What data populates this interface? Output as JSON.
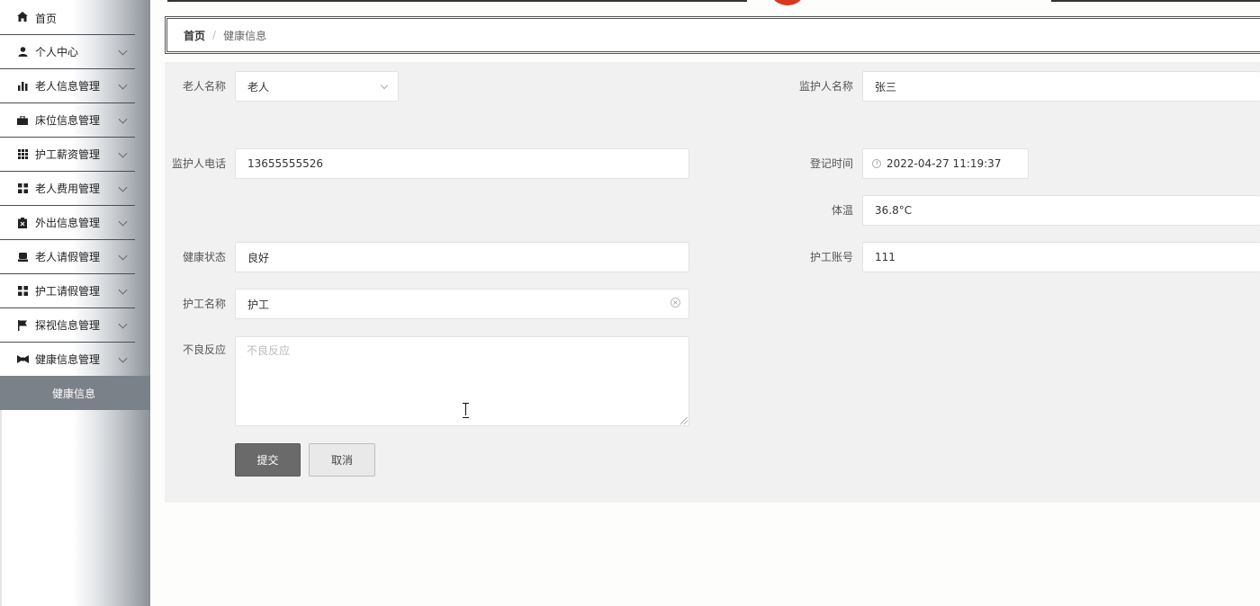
{
  "sidebar": {
    "items": [
      {
        "label": "首页",
        "icon": "home-icon"
      },
      {
        "label": "个人中心",
        "icon": "user-icon"
      },
      {
        "label": "老人信息管理",
        "icon": "bar-chart-icon"
      },
      {
        "label": "床位信息管理",
        "icon": "briefcase-icon"
      },
      {
        "label": "护工薪资管理",
        "icon": "grid-icon"
      },
      {
        "label": "老人费用管理",
        "icon": "apps-icon"
      },
      {
        "label": "外出信息管理",
        "icon": "clipboard-icon"
      },
      {
        "label": "老人请假管理",
        "icon": "print-icon"
      },
      {
        "label": "护工请假管理",
        "icon": "apps-icon"
      },
      {
        "label": "探视信息管理",
        "icon": "flag-icon"
      },
      {
        "label": "健康信息管理",
        "icon": "bowtie-icon"
      }
    ],
    "active_sub": "健康信息"
  },
  "breadcrumb": {
    "home": "首页",
    "separator": "/",
    "current": "健康信息"
  },
  "form": {
    "elder_name": {
      "label": "老人名称",
      "value": "老人"
    },
    "guardian_name": {
      "label": "监护人名称",
      "value": "张三"
    },
    "guardian_phone": {
      "label": "监护人电话",
      "value": "13655555526"
    },
    "register_time": {
      "label": "登记时间",
      "value": "2022-04-27 11:19:37"
    },
    "temperature": {
      "label": "体温",
      "value": "36.8°C"
    },
    "health_status": {
      "label": "健康状态",
      "value": "良好"
    },
    "nurse_account": {
      "label": "护工账号",
      "value": "111"
    },
    "nurse_name": {
      "label": "护工名称",
      "value": "护工"
    },
    "adverse_reaction": {
      "label": "不良反应",
      "placeholder": "不良反应"
    },
    "submit_label": "提交",
    "cancel_label": "取消"
  },
  "colors": {
    "primary_button": "#6a6a6a",
    "panel_bg": "#f1f1f1",
    "submenu_bg": "#7b8188"
  }
}
